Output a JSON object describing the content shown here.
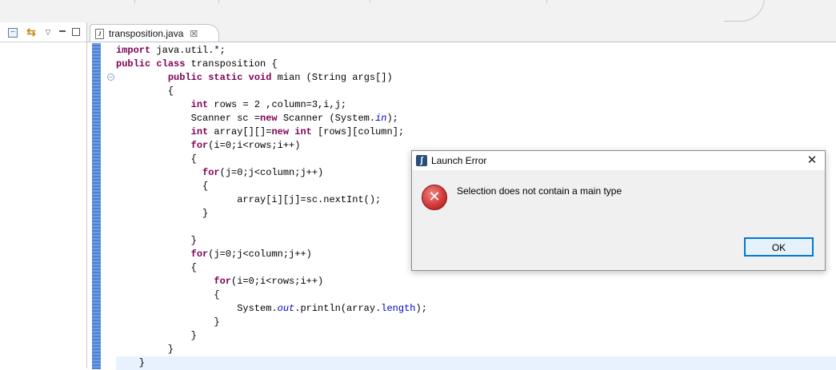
{
  "editor": {
    "tab": {
      "filename": "transposition.java",
      "file_icon": "java-file-icon",
      "close_glyph": "☒"
    },
    "lines": [
      [
        {
          "t": "import",
          "c": "kw"
        },
        {
          "t": " java.util.*;"
        }
      ],
      [
        {
          "t": "public",
          "c": "kw"
        },
        {
          "t": " "
        },
        {
          "t": "class",
          "c": "kw"
        },
        {
          "t": " transposition {"
        }
      ],
      [
        {
          "t": "         "
        },
        {
          "t": "public",
          "c": "kw"
        },
        {
          "t": " "
        },
        {
          "t": "static",
          "c": "kw"
        },
        {
          "t": " "
        },
        {
          "t": "void",
          "c": "kw"
        },
        {
          "t": " mian (String args[])"
        }
      ],
      [
        {
          "t": "         {"
        }
      ],
      [
        {
          "t": "             "
        },
        {
          "t": "int",
          "c": "kw"
        },
        {
          "t": " rows = 2 ,column=3,i,j;"
        }
      ],
      [
        {
          "t": "             Scanner sc ="
        },
        {
          "t": "new",
          "c": "kw"
        },
        {
          "t": " Scanner (System."
        },
        {
          "t": "in",
          "c": "st"
        },
        {
          "t": ");"
        }
      ],
      [
        {
          "t": "             "
        },
        {
          "t": "int",
          "c": "kw"
        },
        {
          "t": " array[][]="
        },
        {
          "t": "new",
          "c": "kw"
        },
        {
          "t": " "
        },
        {
          "t": "int",
          "c": "kw"
        },
        {
          "t": " [rows][column];"
        }
      ],
      [
        {
          "t": "             "
        },
        {
          "t": "for",
          "c": "kw"
        },
        {
          "t": "(i=0;i<rows;i++)"
        }
      ],
      [
        {
          "t": "             {"
        }
      ],
      [
        {
          "t": "               "
        },
        {
          "t": "for",
          "c": "kw"
        },
        {
          "t": "(j=0;j<column;j++)"
        }
      ],
      [
        {
          "t": "               {"
        }
      ],
      [
        {
          "t": "                     array[i][j]=sc.nextInt();"
        }
      ],
      [
        {
          "t": "               }"
        }
      ],
      [
        {
          "t": ""
        }
      ],
      [
        {
          "t": "             }"
        }
      ],
      [
        {
          "t": "             "
        },
        {
          "t": "for",
          "c": "kw"
        },
        {
          "t": "(j=0;j<column;j++)"
        }
      ],
      [
        {
          "t": "             {"
        }
      ],
      [
        {
          "t": "                 "
        },
        {
          "t": "for",
          "c": "kw"
        },
        {
          "t": "(i=0;i<rows;i++)"
        }
      ],
      [
        {
          "t": "                 {"
        }
      ],
      [
        {
          "t": "                     System."
        },
        {
          "t": "out",
          "c": "st"
        },
        {
          "t": ".println(array."
        },
        {
          "t": "length",
          "c": "fd"
        },
        {
          "t": ");"
        }
      ],
      [
        {
          "t": "                 }"
        }
      ],
      [
        {
          "t": "             }"
        }
      ],
      [
        {
          "t": "         }"
        }
      ],
      [
        {
          "t": "    }"
        }
      ]
    ]
  },
  "dialog": {
    "title": "Launch Error",
    "message": "Selection does not contain a main type",
    "ok_label": "OK",
    "close_glyph": "✕",
    "icon": "error-icon",
    "icon_glyph": "✕"
  },
  "left_view": {
    "icons": [
      "collapse-all-icon",
      "link-with-editor-icon",
      "view-menu-icon",
      "minimize-icon",
      "maximize-icon"
    ]
  }
}
